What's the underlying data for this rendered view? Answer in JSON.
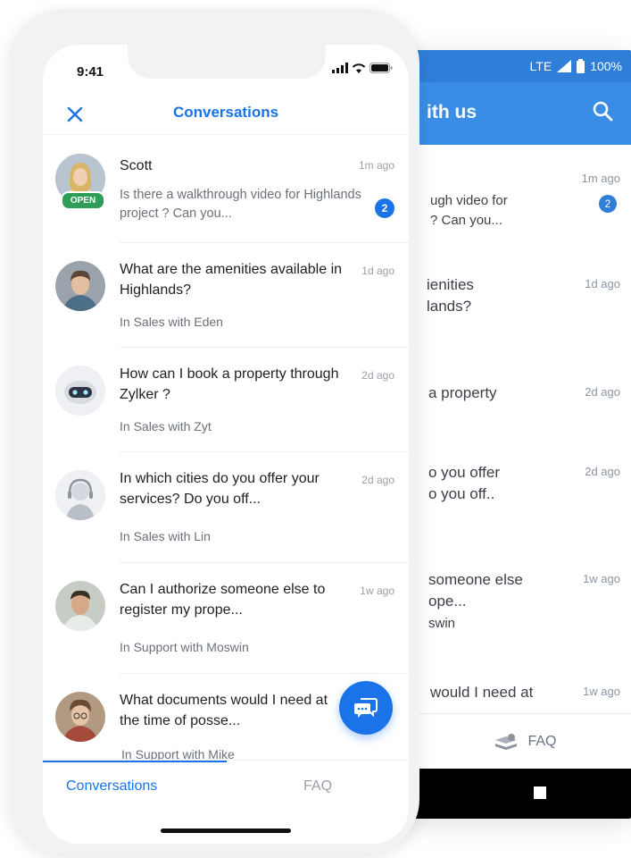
{
  "android": {
    "status": {
      "network": "LTE",
      "battery": "100%"
    },
    "toolbar_title": "ith us",
    "items": [
      {
        "time": "1m ago",
        "line1": "ugh video for",
        "line2": "? Can you...",
        "badge": "2"
      },
      {
        "time": "1d ago",
        "line1": "ienities",
        "line2": "lands?"
      },
      {
        "time": "2d ago",
        "line1": "a property"
      },
      {
        "time": "2d ago",
        "line1": "o you offer",
        "line2": "o you off.."
      },
      {
        "time": "1w ago",
        "line1": "someone else",
        "line2": "ope...",
        "line3": "swin"
      },
      {
        "time": "1w ago",
        "line1": "would I need at"
      }
    ],
    "faq_label": "FAQ"
  },
  "ios": {
    "time": "9:41",
    "header_title": "Conversations",
    "conversations": [
      {
        "name": "Scott",
        "time": "1m ago",
        "preview": "Is there a walkthrough video for Highlands project ? Can you...",
        "badge": "2",
        "tag": "OPEN"
      },
      {
        "title": "What are the amenities available in Highlands?",
        "time": "1d ago",
        "meta": "In Sales with Eden"
      },
      {
        "title": "How can I book a property through Zylker ?",
        "time": "2d ago",
        "meta": "In Sales with Zyt"
      },
      {
        "title": "In which cities do you offer your services? Do you off...",
        "time": "2d ago",
        "meta": "In Sales with Lin"
      },
      {
        "title": "Can I authorize someone else to register my prope...",
        "time": "1w ago",
        "meta": "In Support with Moswin"
      },
      {
        "title": "What documents would I need at the time of posse...",
        "time": "",
        "meta": "In Support with Mike"
      }
    ],
    "tabs": {
      "conversations": "Conversations",
      "faq": "FAQ"
    }
  }
}
